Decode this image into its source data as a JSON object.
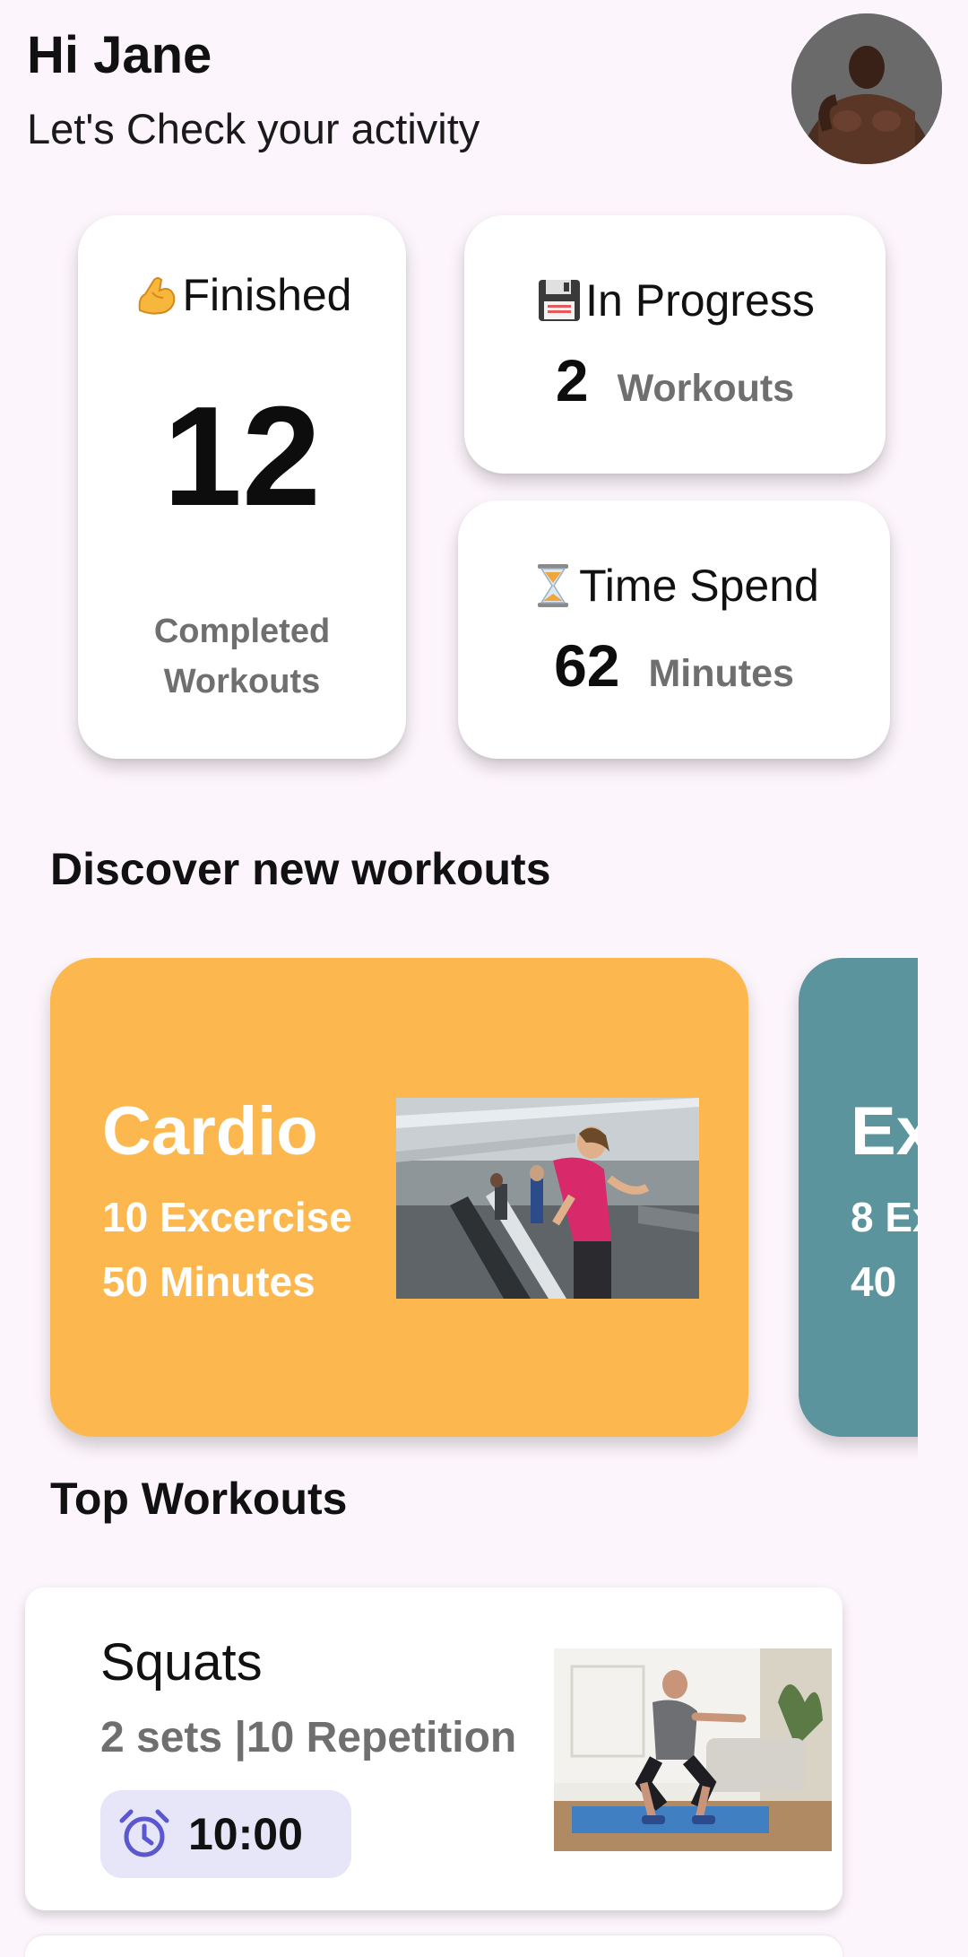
{
  "header": {
    "greeting": "Hi Jane",
    "subtitle": "Let's Check your activity",
    "avatar_icon": "user-avatar"
  },
  "stats": {
    "finished": {
      "icon": "flexed-biceps-emoji",
      "title": "Finished",
      "value": "12",
      "footer_line1": "Completed",
      "footer_line2": "Workouts"
    },
    "in_progress": {
      "icon": "floppy-disk-emoji",
      "title": "In Progress",
      "value": "2",
      "unit": "Workouts"
    },
    "time_spend": {
      "icon": "hourglass-emoji",
      "title": "Time Spend",
      "value": "62",
      "unit": "Minutes"
    }
  },
  "discover": {
    "heading": "Discover new workouts",
    "cards": [
      {
        "name": "Cardio",
        "line1": "10 Excercise",
        "line2": "50 Minutes",
        "color": "#fcb84f"
      },
      {
        "name": "Ex",
        "line1": "8 Ex",
        "line2": "40",
        "color": "#5b949c"
      }
    ]
  },
  "top_workouts": {
    "heading": "Top Workouts",
    "items": [
      {
        "name": "Squats",
        "details": "2 sets |10 Repetition",
        "duration": "10:00",
        "icon": "alarm-clock-icon"
      }
    ]
  },
  "colors": {
    "background": "#fcf5fb",
    "cardio": "#fcb84f",
    "second_card": "#5b949c",
    "timer_chip": "#e6e6f8",
    "timer_icon": "#5b57cf"
  }
}
